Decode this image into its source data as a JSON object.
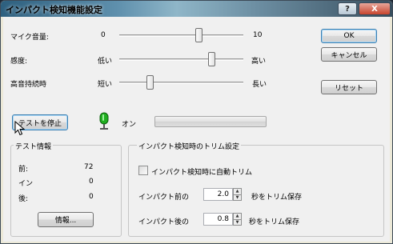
{
  "window": {
    "title": "インパクト検知機能設定",
    "help_label": "?",
    "close_label": "X"
  },
  "sliders": [
    {
      "label": "マイク音量:",
      "min_label": "0",
      "max_label": "10",
      "level": 0.65
    },
    {
      "label": "感度:",
      "min_label": "低い",
      "max_label": "高い",
      "level": 0.76
    },
    {
      "label": "高音持続時",
      "min_label": "短い",
      "max_label": "長い",
      "level": 0.23
    }
  ],
  "buttons": {
    "ok": "OK",
    "cancel": "キャンセル",
    "reset": "リセット",
    "stop_test": "テストを停止",
    "info": "情報..."
  },
  "indicator": {
    "status_label": "オン",
    "color": "#1fae1f"
  },
  "test_info": {
    "title": "テスト情報",
    "rows": [
      {
        "label": "前:",
        "value": "72"
      },
      {
        "label": "イン",
        "value": "0"
      },
      {
        "label": "後:",
        "value": "0"
      }
    ]
  },
  "trim": {
    "title": "インパクト検知時のトリム設定",
    "auto_trim_label": "インパクト検知時に自動トリム",
    "auto_trim_checked": false,
    "before_label": "インパクト前の",
    "before_value": "2.0",
    "before_suffix": "秒をトリム保存",
    "after_label": "インパクト後の",
    "after_value": "0.8",
    "after_suffix": "秒をトリム保存"
  }
}
